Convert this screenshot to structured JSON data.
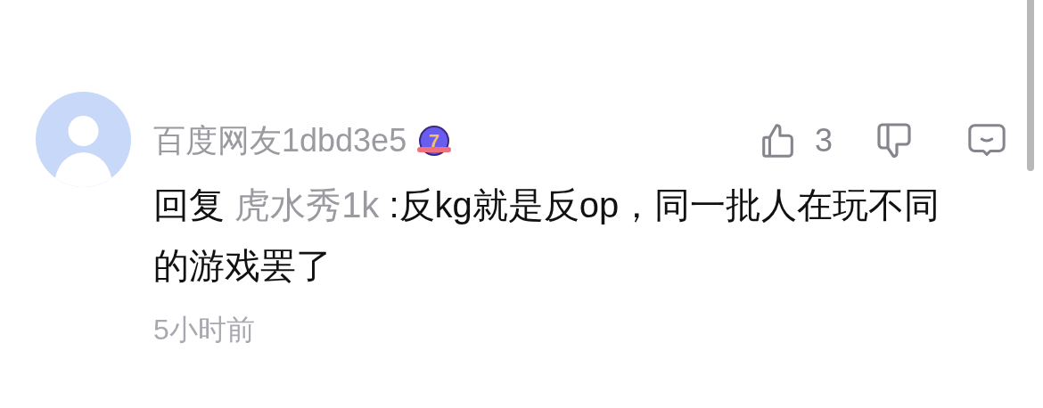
{
  "comment": {
    "author": "百度网友1dbd3e5",
    "level_badge": "7",
    "likes": "3",
    "reply_prefix": "回复",
    "reply_to": "虎水秀1k",
    "text": " :反kg就是反op，同一批人在玩不同的游戏罢了",
    "time": "5小时前"
  }
}
